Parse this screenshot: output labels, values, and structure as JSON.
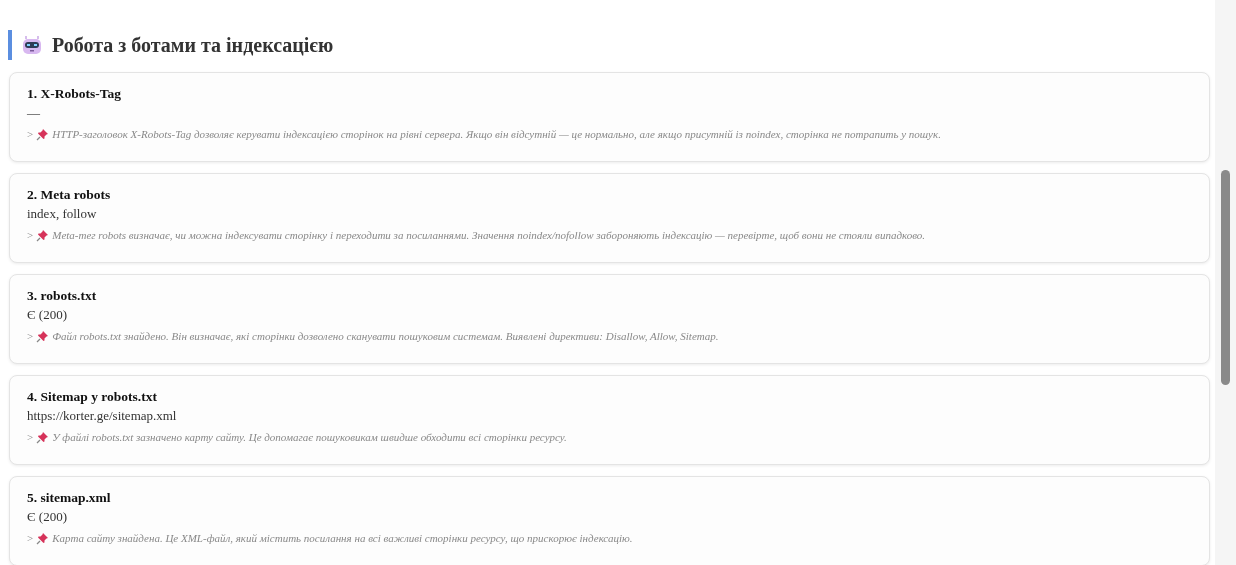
{
  "section": {
    "title": "Робота з ботами та індексацією"
  },
  "checks": [
    {
      "title": "1. X-Robots-Tag",
      "value": "—",
      "marker": ">",
      "note": "HTTP-заголовок X-Robots-Tag дозволяє керувати індексацією сторінок на рівні сервера. Якщо він відсутній — це нормально, але якщо присутній із noindex, сторінка не потрапить у пошук."
    },
    {
      "title": "2. Meta robots",
      "value": "index, follow",
      "marker": ">",
      "note": "Meta-тег robots визначає, чи можна індексувати сторінку і переходити за посиланнями. Значення noindex/nofollow забороняють індексацію — перевірте, щоб вони не стояли випадково."
    },
    {
      "title": "3. robots.txt",
      "value": "Є (200)",
      "marker": ">",
      "note": "Файл robots.txt знайдено. Він визначає, які сторінки дозволено сканувати пошуковим системам. Виявлені директиви: Disallow, Allow, Sitemap."
    },
    {
      "title": "4. Sitemap у robots.txt",
      "value": "https://korter.ge/sitemap.xml",
      "marker": ">",
      "note": "У файлі robots.txt зазначено карту сайту. Це допомагає пошуковикам швидше обходити всі сторінки ресурсу."
    },
    {
      "title": "5. sitemap.xml",
      "value": "Є (200)",
      "marker": ">",
      "note": "Карта сайту знайдена. Це XML-файл, який містить посилання на всі важливі сторінки ресурсу, що прискорює індексацію."
    }
  ]
}
